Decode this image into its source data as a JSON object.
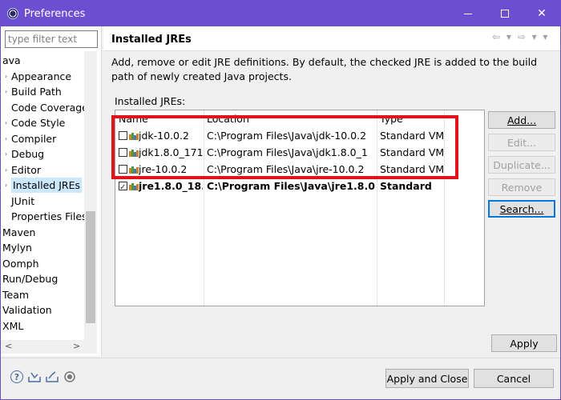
{
  "window": {
    "title": "Preferences"
  },
  "sidebar": {
    "filter_placeholder": "type filter text",
    "items": [
      {
        "label": "ava",
        "arrow": ""
      },
      {
        "label": "Appearance",
        "arrow": "›"
      },
      {
        "label": "Build Path",
        "arrow": "›"
      },
      {
        "label": "Code Coverage",
        "arrow": ""
      },
      {
        "label": "Code Style",
        "arrow": "›"
      },
      {
        "label": "Compiler",
        "arrow": "›"
      },
      {
        "label": "Debug",
        "arrow": "›"
      },
      {
        "label": "Editor",
        "arrow": "›"
      },
      {
        "label": "Installed JREs",
        "arrow": "›"
      },
      {
        "label": "JUnit",
        "arrow": ""
      },
      {
        "label": "Properties Files",
        "arrow": ""
      },
      {
        "label": "Maven",
        "arrow": ""
      },
      {
        "label": "Mylyn",
        "arrow": ""
      },
      {
        "label": "Oomph",
        "arrow": ""
      },
      {
        "label": "Run/Debug",
        "arrow": ""
      },
      {
        "label": "Team",
        "arrow": ""
      },
      {
        "label": "Validation",
        "arrow": ""
      },
      {
        "label": "XML",
        "arrow": ""
      }
    ],
    "scroll_left": "<",
    "scroll_right": ">"
  },
  "page": {
    "title": "Installed JREs",
    "nav": "⇦ ▾ ⇨ ▾ ▾",
    "description": "Add, remove or edit JRE definitions. By default, the checked JRE is added to the build path of newly created Java projects.",
    "list_label": "Installed JREs:"
  },
  "table": {
    "headers": {
      "name": "Name",
      "location": "Location",
      "type": "Type"
    },
    "rows": [
      {
        "name": "jdk-10.0.2",
        "location": "C:\\Program Files\\Java\\jdk-10.0.2",
        "type": "Standard VM",
        "checked": false,
        "bold": false
      },
      {
        "name": "jdk1.8.0_171",
        "location": "C:\\Program Files\\Java\\jdk1.8.0_1",
        "type": "Standard VM",
        "checked": false,
        "bold": false
      },
      {
        "name": "jre-10.0.2",
        "location": "C:\\Program Files\\Java\\jre-10.0.2",
        "type": "Standard VM",
        "checked": false,
        "bold": false
      },
      {
        "name": "jre1.8.0_18...",
        "location": "C:\\Program Files\\Java\\jre1.8.0...",
        "type": "Standard",
        "checked": true,
        "bold": true
      }
    ]
  },
  "buttons": {
    "add": "Add...",
    "edit": "Edit...",
    "duplicate": "Duplicate...",
    "remove": "Remove",
    "search": "Search...",
    "apply": "Apply",
    "apply_close": "Apply and Close",
    "cancel": "Cancel"
  },
  "colors": {
    "titlebar": "#6b4fd0",
    "highlight": "#e2121b",
    "selection": "#cce8ff"
  }
}
